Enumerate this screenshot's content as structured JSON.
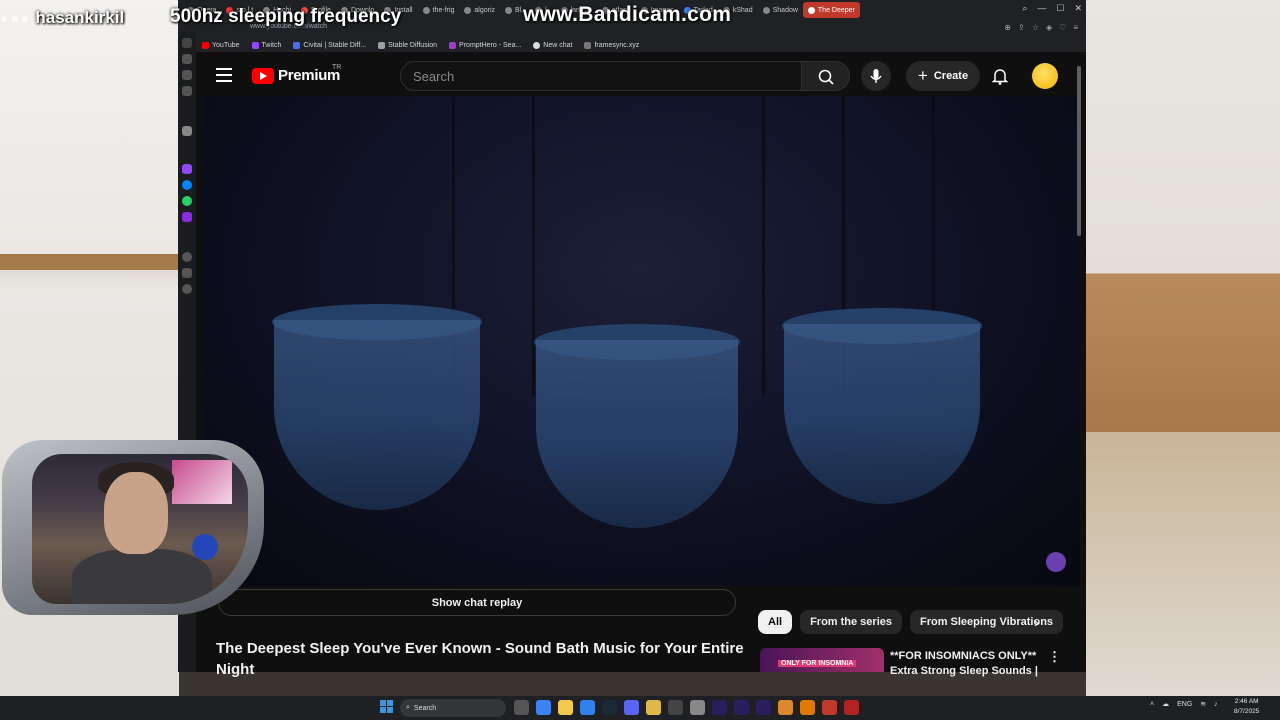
{
  "overlay": {
    "username": "hasankirkil",
    "stream_title": "500hz sleeping frequency",
    "watermark": "www.Bandicam.com"
  },
  "browser": {
    "tabs": [
      "Opera",
      "s.p.l.t",
      "Hachi",
      "Profile",
      "Downlo",
      "Install",
      "the-frig",
      "algoriz",
      "Bl..",
      "l..",
      "lam-bo",
      "atlanti",
      "Images",
      "Tarlad",
      "kShad",
      "Shadow",
      "The Deeper"
    ],
    "active_tab_index": 16,
    "url": "www.youtube.com/watch",
    "bookmarks": [
      "YouTube",
      "Twitch",
      "Civitai | Stable Diff...",
      "Stable Diffusion",
      "PromptHero - Sea...",
      "New chat",
      "framesync.xyz"
    ]
  },
  "youtube": {
    "logo_text": "Premium",
    "country_code": "TR",
    "search_placeholder": "Search",
    "create_label": "Create",
    "show_chat_replay": "Show chat replay",
    "video_title": "The Deepest Sleep You've Ever Known - Sound Bath Music for Your Entire Night",
    "chips": [
      "All",
      "From the series",
      "From Sleeping Vibrations"
    ],
    "active_chip_index": 0,
    "recommendation": {
      "title": "**FOR INSOMNIACS ONLY** Extra Strong Sleep Sounds |",
      "thumb_tag": "ONLY FOR INSOMNIA"
    }
  },
  "taskbar": {
    "search_label": "Search",
    "language": "ENG",
    "time": "2:46 AM",
    "date": "8/7/2025"
  },
  "colors": {
    "yt_red": "#ff0000",
    "accent_tab": "#c0392b",
    "background": "#0f0f0f"
  }
}
